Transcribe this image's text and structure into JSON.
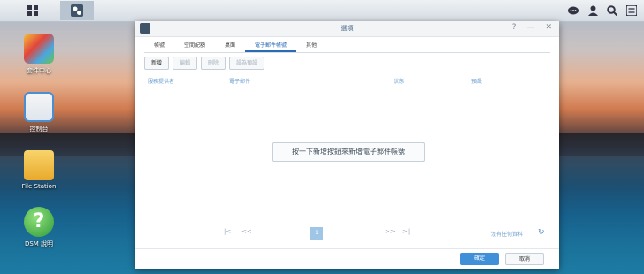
{
  "window": {
    "title": "選項",
    "controls": {
      "help": "?",
      "minimize": "—",
      "close": "✕"
    }
  },
  "tabs": [
    {
      "label": "帳號"
    },
    {
      "label": "空間配額"
    },
    {
      "label": "桌面"
    },
    {
      "label": "電子郵件帳號",
      "active": true
    },
    {
      "label": "其他"
    }
  ],
  "toolbar": {
    "add": "新增",
    "edit": "編輯",
    "delete": "刪除",
    "set_default": "設為預設"
  },
  "columns": {
    "provider": "服務提供者",
    "email": "電子郵件",
    "status": "狀態",
    "default": "預設"
  },
  "empty_message": "按一下新增按鈕來新增電子郵件帳號",
  "pager": {
    "first": "|<",
    "prev": "<<",
    "page": "1",
    "next": ">>",
    "last": ">|",
    "no_data": "沒有任何資料"
  },
  "footer": {
    "ok": "確定",
    "cancel": "取消"
  },
  "desktop_icons": [
    {
      "label": "套件中心"
    },
    {
      "label": "控制台"
    },
    {
      "label": "File Station"
    },
    {
      "label": "DSM 說明"
    }
  ],
  "colors": {
    "accent": "#2a6bb3",
    "ok_button": "#3f8fd9",
    "column_header": "#6a9fd0"
  }
}
